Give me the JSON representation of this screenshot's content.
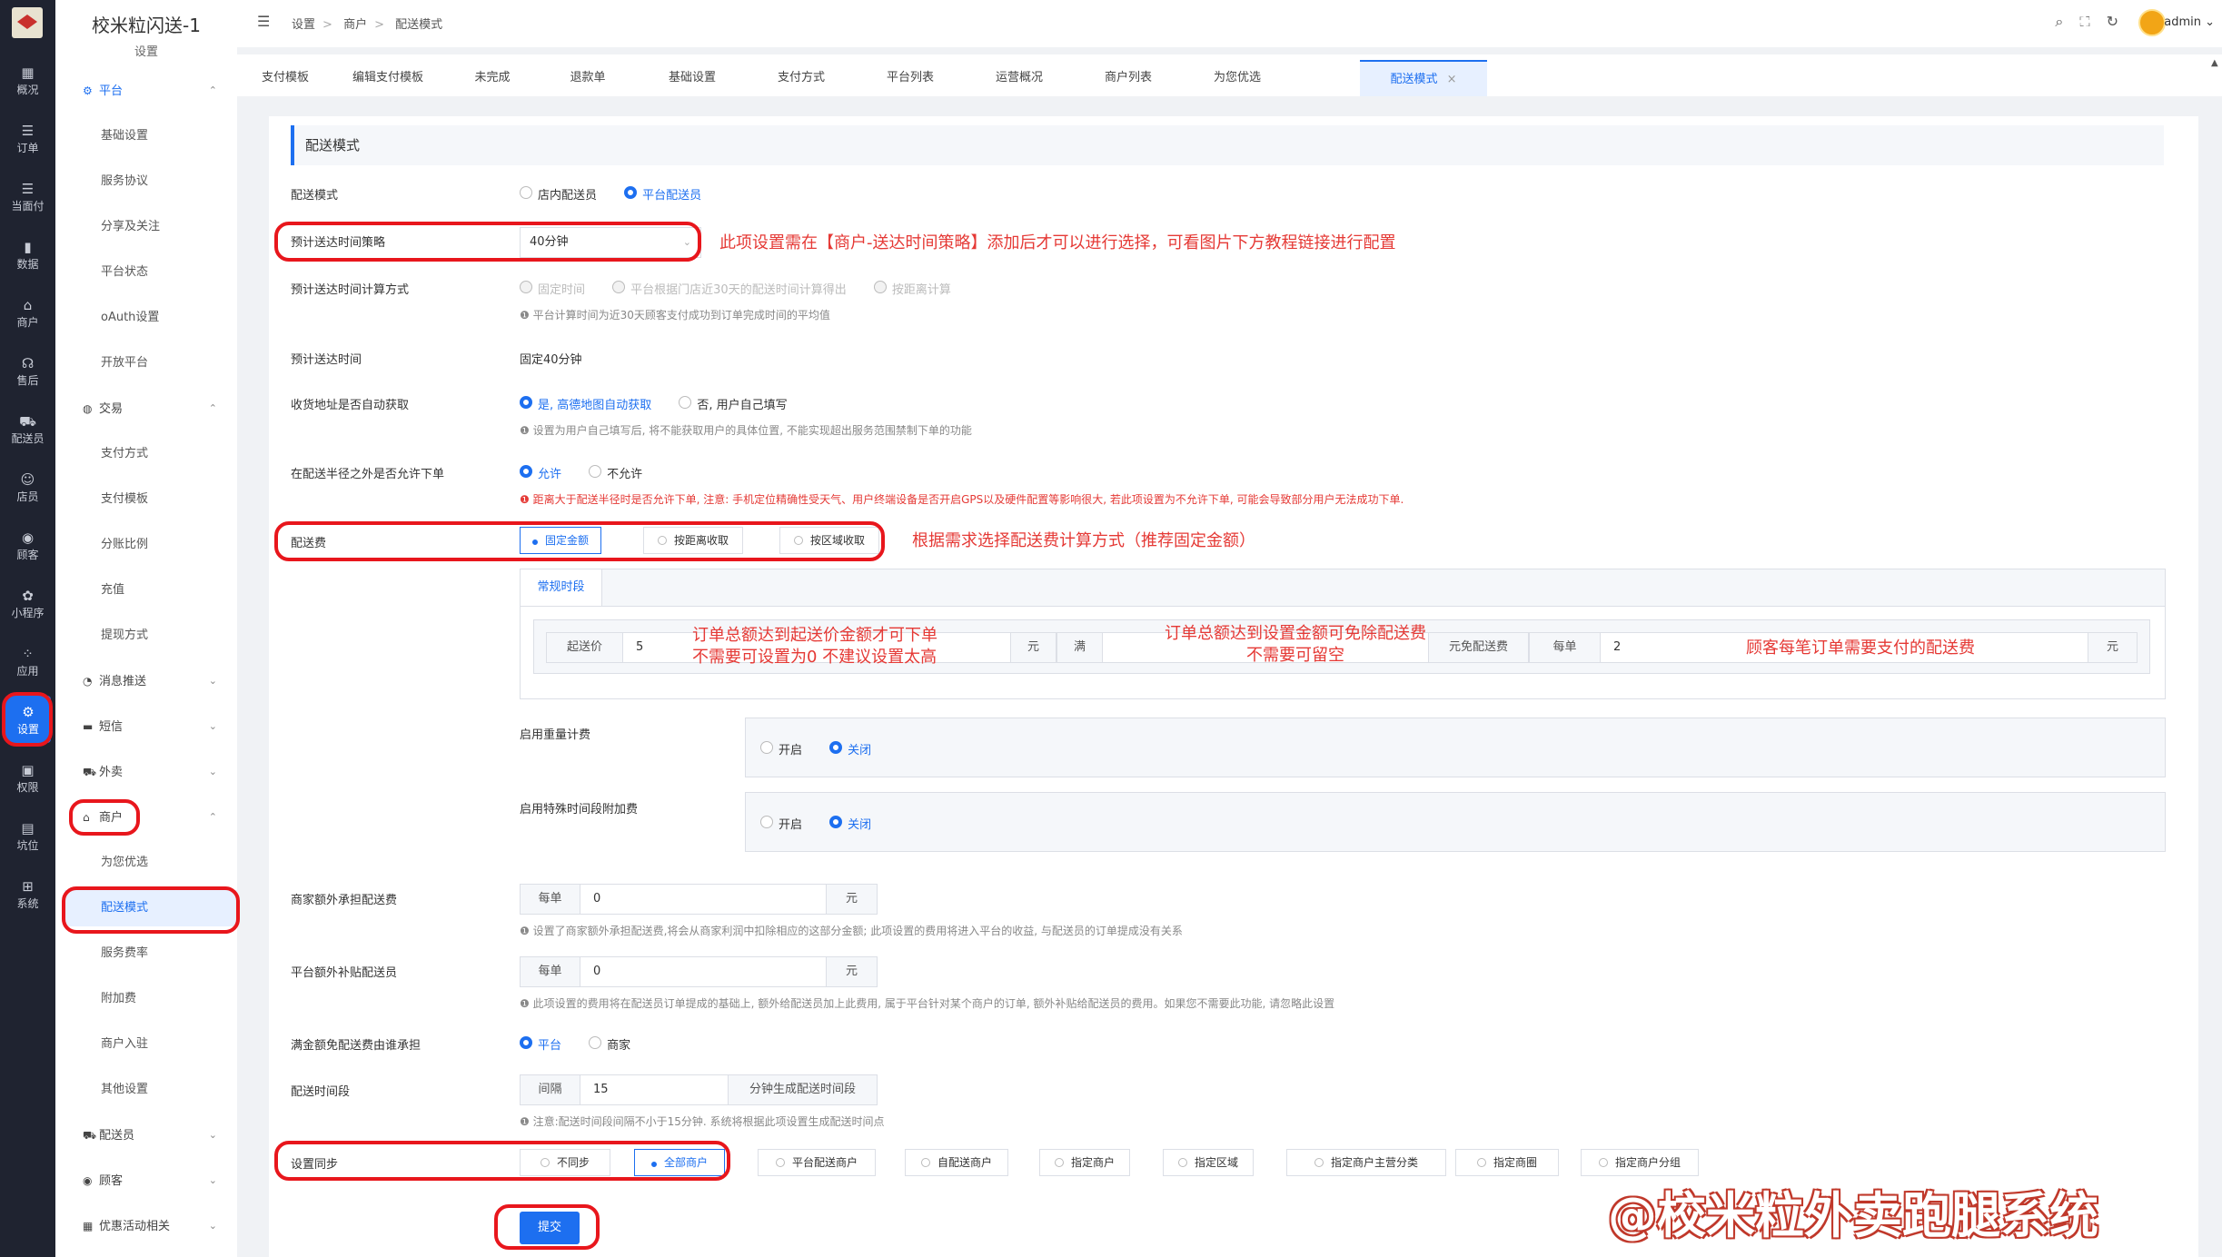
{
  "rail": {
    "items": [
      {
        "label": "概况",
        "icon": "grid-icon"
      },
      {
        "label": "订单",
        "icon": "list-icon"
      },
      {
        "label": "当面付",
        "icon": "list-icon"
      },
      {
        "label": "数据",
        "icon": "bar-chart-icon"
      },
      {
        "label": "商户",
        "icon": "store-icon"
      },
      {
        "label": "售后",
        "icon": "headset-icon"
      },
      {
        "label": "配送员",
        "icon": "scooter-icon"
      },
      {
        "label": "店员",
        "icon": "person-icon"
      },
      {
        "label": "顾客",
        "icon": "customer-icon"
      },
      {
        "label": "小程序",
        "icon": "miniapp-icon"
      },
      {
        "label": "应用",
        "icon": "apps-icon"
      },
      {
        "label": "设置",
        "icon": "settings-user-icon"
      },
      {
        "label": "权限",
        "icon": "lock-icon"
      },
      {
        "label": "坑位",
        "icon": "file-icon"
      },
      {
        "label": "系统",
        "icon": "windows-icon"
      }
    ]
  },
  "sidebar": {
    "brand": "校米粒闪送-1",
    "subtitle": "设置",
    "groups": [
      {
        "label": "平台",
        "icon": "gear-icon",
        "items": [
          "基础设置",
          "服务协议",
          "分享及关注",
          "平台状态",
          "oAuth设置",
          "开放平台"
        ]
      },
      {
        "label": "交易",
        "icon": "trade-icon",
        "items": [
          "支付方式",
          "支付模板",
          "分账比例",
          "充值",
          "提现方式"
        ]
      },
      {
        "label": "消息推送",
        "icon": "message-icon"
      },
      {
        "label": "短信",
        "icon": "sms-icon"
      },
      {
        "label": "外卖",
        "icon": "takeout-icon"
      },
      {
        "label": "商户",
        "icon": "store-icon",
        "items": [
          "为您优选",
          "配送模式",
          "服务费率",
          "附加费",
          "商户入驻",
          "其他设置"
        ]
      },
      {
        "label": "配送员",
        "icon": "courier-icon"
      },
      {
        "label": "顾客",
        "icon": "customer-icon"
      },
      {
        "label": "优惠活动相关",
        "icon": "coupon-icon"
      }
    ]
  },
  "topbar": {
    "crumbs": [
      "设置",
      "商户",
      "配送模式"
    ],
    "user": "admin"
  },
  "tabs": [
    "支付模板",
    "编辑支付模板",
    "未完成",
    "退款单",
    "基础设置",
    "支付方式",
    "平台列表",
    "运营概况",
    "商户列表",
    "为您优选",
    "配送模式"
  ],
  "form": {
    "section_title": "配送模式",
    "mode": {
      "label": "配送模式",
      "options": [
        "店内配送员",
        "平台配送员"
      ],
      "selected": 1
    },
    "strategy": {
      "label": "预计送达时间策略",
      "value": "40分钟"
    },
    "calc": {
      "label": "预计送达时间计算方式",
      "options": [
        "固定时间",
        "平台根据门店近30天的配送时间计算得出",
        "按距离计算"
      ],
      "hint": "平台计算时间为近30天顾客支付成功到订单完成时间的平均值"
    },
    "eta": {
      "label": "预计送达时间",
      "value": "固定40分钟"
    },
    "address": {
      "label": "收货地址是否自动获取",
      "options": [
        "是, 高德地图自动获取",
        "否, 用户自己填写"
      ],
      "selected": 0,
      "hint": "设置为用户自己填写后, 将不能获取用户的具体位置, 不能实现超出服务范围禁制下单的功能"
    },
    "radius": {
      "label": "在配送半径之外是否允许下单",
      "options": [
        "允许",
        "不允许"
      ],
      "selected": 0,
      "hint": "距离大于配送半径时是否允许下单, 注意: 手机定位精确性受天气、用户终端设备是否开启GPS以及硬件配置等影响很大, 若此项设置为不允许下单, 可能会导致部分用户无法成功下单."
    },
    "fee": {
      "label": "配送费",
      "options": [
        "固定金额",
        "按距离收取",
        "按区域收取"
      ],
      "selected": 0,
      "tab": "常规时段",
      "start_prefix": "起送价",
      "start_value": "5",
      "yuan": "元",
      "full": "满",
      "free_suffix": "元免配送费",
      "per": "每单",
      "per_value": "2"
    },
    "weight": {
      "label": "启用重量计费",
      "options": [
        "开启",
        "关闭"
      ],
      "selected": 1
    },
    "special": {
      "label": "启用特殊时间段附加费",
      "options": [
        "开启",
        "关闭"
      ],
      "selected": 1
    },
    "merchant_extra": {
      "label": "商家额外承担配送费",
      "prefix": "每单",
      "value": "0",
      "suffix": "元",
      "hint": "设置了商家额外承担配送费,将会从商家利润中扣除相应的这部分金额; 此项设置的费用将进入平台的收益, 与配送员的订单提成没有关系"
    },
    "platform_extra": {
      "label": "平台额外补贴配送员",
      "prefix": "每单",
      "value": "0",
      "suffix": "元",
      "hint": "此项设置的费用将在配送员订单提成的基础上, 额外给配送员加上此费用, 属于平台针对某个商户的订单, 额外补贴给配送员的费用。如果您不需要此功能, 请忽略此设置"
    },
    "free_bearer": {
      "label": "满金额免配送费由谁承担",
      "options": [
        "平台",
        "商家"
      ],
      "selected": 0
    },
    "interval": {
      "label": "配送时间段",
      "prefix": "间隔",
      "value": "15",
      "suffix": "分钟生成配送时间段",
      "hint": "注意:配送时间段间隔不小于15分钟. 系统将根据此项设置生成配送时间点"
    },
    "sync": {
      "label": "设置同步",
      "options": [
        "不同步",
        "全部商户",
        "平台配送商户",
        "自配送商户",
        "指定商户",
        "指定区域",
        "指定商户主营分类",
        "指定商圈",
        "指定商户分组"
      ],
      "selected": 1
    },
    "submit": "提交"
  },
  "annotations": {
    "strategy_note": "此项设置需在【商户-送达时间策略】添加后才可以进行选择，可看图片下方教程链接进行配置",
    "fee_note": "根据需求选择配送费计算方式（推荐固定金额）",
    "start_note_1": "订单总额达到起送价金额才可下单",
    "start_note_2": "不需要可设置为0 不建议设置太高",
    "free_note_1": "订单总额达到设置金额可免除配送费",
    "free_note_2": "不需要可留空",
    "per_note": "顾客每笔订单需要支付的配送费",
    "watermark": "@校米粒外卖跑腿系统"
  },
  "colors": {
    "accent": "#1d6ff0",
    "annotation_red": "#e8161c",
    "rail_bg": "#1f2330"
  }
}
